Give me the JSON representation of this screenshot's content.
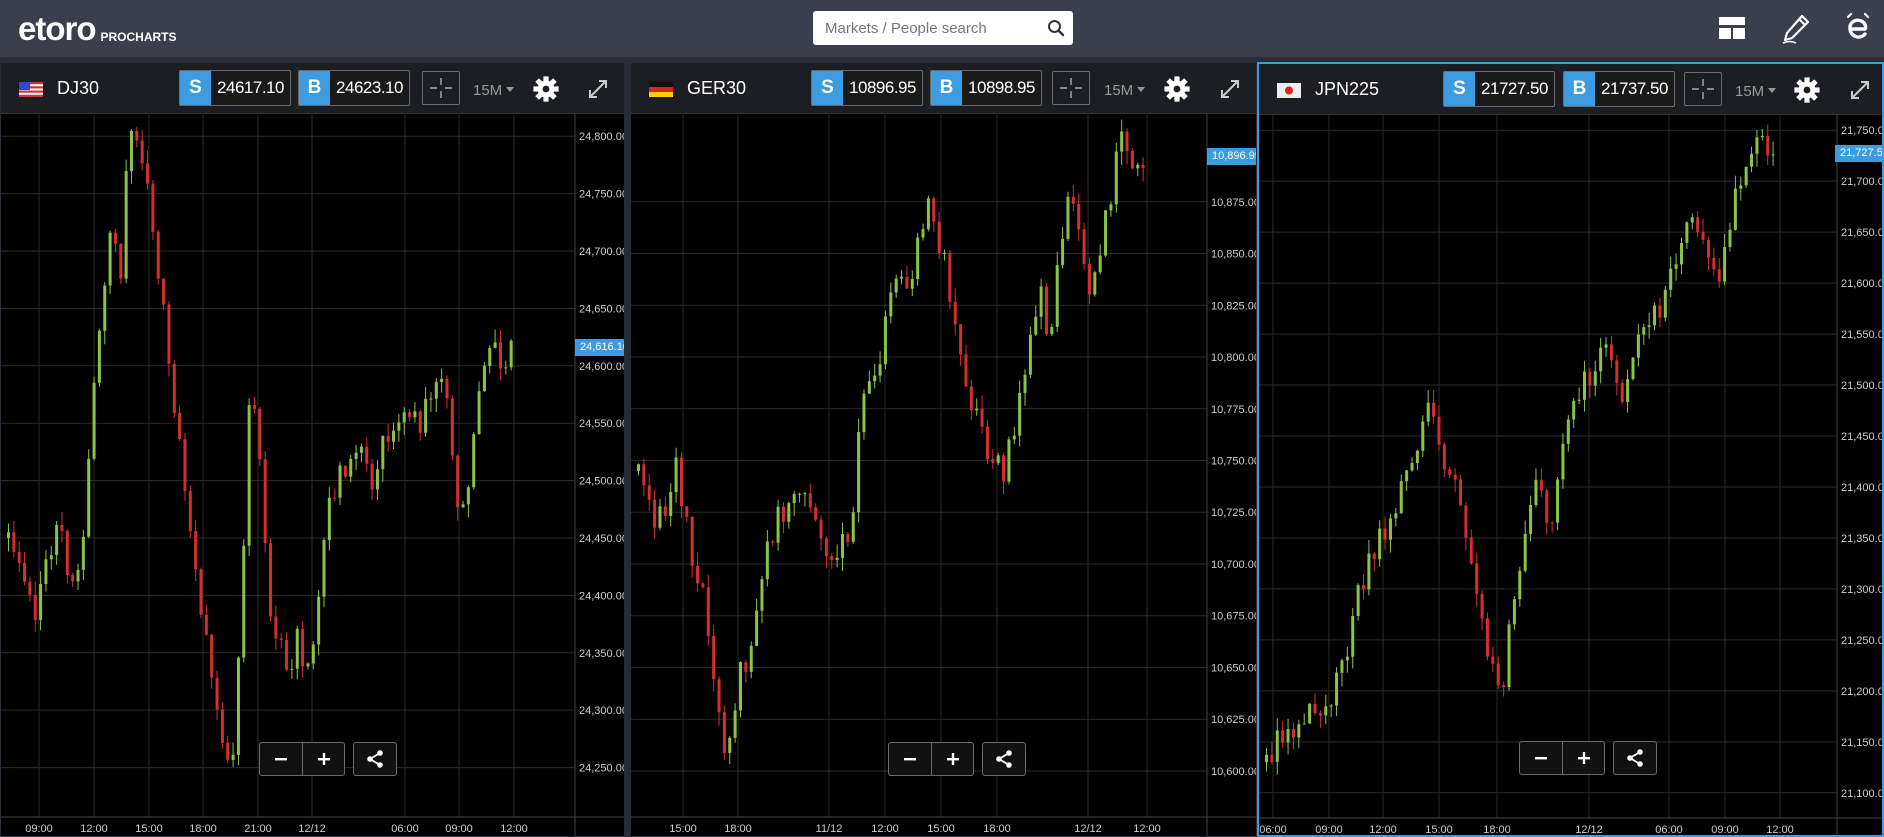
{
  "app": {
    "brand": "eToro",
    "logo_text": "etoro",
    "logo_sub": "PROCHARTS"
  },
  "search": {
    "placeholder": "Markets / People search",
    "icon": "search-icon"
  },
  "toolbar_icons": [
    "layout-icon",
    "pen-icon",
    "etoro-e-icon"
  ],
  "colors": {
    "accent": "#3d9be0",
    "up": "#8bc34a",
    "down": "#d32f2f",
    "topbar": "#3a3f4b",
    "panel_header": "#1c1e24"
  },
  "panels": [
    {
      "symbol": "DJ30",
      "flag": "US",
      "sell_label": "S",
      "sell_price": "24617.10",
      "buy_label": "B",
      "buy_price": "24623.10",
      "timeframe": "15M",
      "y_ticks": [
        "24,800.00",
        "24,750.00",
        "24,700.00",
        "24,650.00",
        "24,600.00",
        "24,550.00",
        "24,500.00",
        "24,450.00",
        "24,400.00",
        "24,350.00",
        "24,300.00",
        "24,250.00"
      ],
      "y_values": [
        24800,
        24750,
        24700,
        24650,
        24600,
        24550,
        24500,
        24450,
        24400,
        24350,
        24300,
        24250
      ],
      "x_ticks": [
        "09:00",
        "12:00",
        "15:00",
        "18:00",
        "21:00",
        "12/12",
        "06:00",
        "09:00",
        "12:00"
      ],
      "price_label": "24,616.10",
      "price_value": 24616.1,
      "y_range": [
        24220,
        24815
      ],
      "path": [
        24450,
        24420,
        24395,
        24380,
        24430,
        24460,
        24440,
        24400,
        24460,
        24560,
        24640,
        24710,
        24680,
        24810,
        24790,
        24750,
        24680,
        24620,
        24560,
        24500,
        24430,
        24380,
        24330,
        24260,
        24240,
        24380,
        24590,
        24530,
        24400,
        24360,
        24320,
        24370,
        24330,
        24380,
        24460,
        24490,
        24510,
        24520,
        24540,
        24500,
        24530,
        24540,
        24560,
        24570,
        24540,
        24580,
        24590,
        24570,
        24480,
        24470,
        24540,
        24590,
        24630,
        24600,
        24615
      ]
    },
    {
      "symbol": "GER30",
      "flag": "DE",
      "sell_label": "S",
      "sell_price": "10896.95",
      "buy_label": "B",
      "buy_price": "10898.95",
      "timeframe": "15M",
      "y_ticks": [
        "10,875.00",
        "10,850.00",
        "10,825.00",
        "10,800.00",
        "10,775.00",
        "10,750.00",
        "10,725.00",
        "10,700.00",
        "10,675.00",
        "10,650.00",
        "10,625.00",
        "10,600.00"
      ],
      "y_values": [
        10875,
        10850,
        10825,
        10800,
        10775,
        10750,
        10725,
        10700,
        10675,
        10650,
        10625,
        10600
      ],
      "x_ticks": [
        "15:00",
        "18:00",
        "11/12",
        "12:00",
        "15:00",
        "18:00",
        "12/12",
        "12:00"
      ],
      "price_label": "10,896.95",
      "price_value": 10896.95,
      "y_range": [
        10585,
        10915
      ],
      "path": [
        10745,
        10735,
        10720,
        10730,
        10745,
        10720,
        10700,
        10680,
        10650,
        10610,
        10620,
        10650,
        10660,
        10690,
        10710,
        10725,
        10730,
        10740,
        10735,
        10720,
        10710,
        10700,
        10710,
        10730,
        10780,
        10790,
        10800,
        10830,
        10840,
        10825,
        10860,
        10875,
        10860,
        10840,
        10810,
        10790,
        10770,
        10760,
        10750,
        10740,
        10760,
        10790,
        10810,
        10830,
        10800,
        10850,
        10880,
        10860,
        10830,
        10840,
        10870,
        10890,
        10910,
        10895,
        10897
      ]
    },
    {
      "symbol": "JPN225",
      "flag": "JP",
      "sell_label": "S",
      "sell_price": "21727.50",
      "buy_label": "B",
      "buy_price": "21737.50",
      "timeframe": "15M",
      "y_ticks": [
        "21,750.00",
        "21,700.00",
        "21,650.00",
        "21,600.00",
        "21,550.00",
        "21,500.00",
        "21,450.00",
        "21,400.00",
        "21,350.00",
        "21,300.00",
        "21,250.00",
        "21,200.00",
        "21,150.00",
        "21,100.00"
      ],
      "y_values": [
        21750,
        21700,
        21650,
        21600,
        21550,
        21500,
        21450,
        21400,
        21350,
        21300,
        21250,
        21200,
        21150,
        21100
      ],
      "x_ticks": [
        "06:00",
        "09:00",
        "12:00",
        "15:00",
        "18:00",
        "12/12",
        "06:00",
        "09:00",
        "12:00"
      ],
      "price_label": "21,727.50",
      "price_value": 21727.5,
      "y_range": [
        21090,
        21760
      ],
      "path": [
        21130,
        21150,
        21160,
        21140,
        21170,
        21190,
        21180,
        21200,
        21230,
        21260,
        21300,
        21330,
        21350,
        21370,
        21390,
        21410,
        21440,
        21470,
        21460,
        21430,
        21400,
        21360,
        21310,
        21270,
        21230,
        21200,
        21260,
        21330,
        21390,
        21420,
        21360,
        21400,
        21460,
        21490,
        21500,
        21520,
        21540,
        21500,
        21480,
        21520,
        21550,
        21560,
        21580,
        21600,
        21640,
        21680,
        21650,
        21620,
        21600,
        21640,
        21690,
        21720,
        21740,
        21730,
        21727
      ]
    }
  ]
}
